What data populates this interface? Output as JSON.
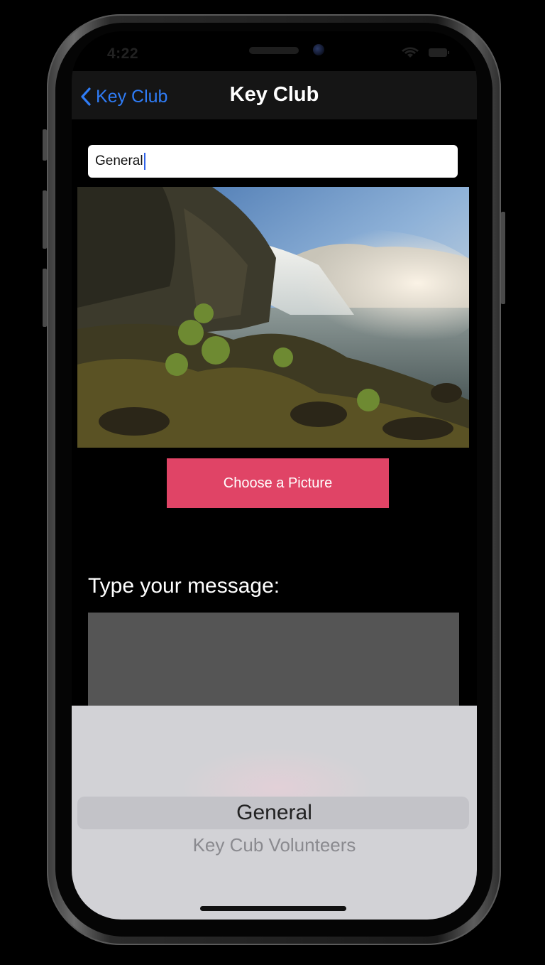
{
  "status_bar": {
    "time": "4:22"
  },
  "navbar": {
    "back_label": "Key Club",
    "title": "Key Club"
  },
  "topic_field": {
    "value": "General"
  },
  "hero_image": {
    "subject": "waterfall landscape photo"
  },
  "choose_button": {
    "label": "Choose a Picture"
  },
  "message": {
    "label": "Type your message:",
    "value": ""
  },
  "picker": {
    "options": [
      "General",
      "Key Cub Volunteers"
    ],
    "selected": "General"
  },
  "colors": {
    "accent_blue": "#2f7cf6",
    "button_pink": "#e04466",
    "message_area": "#555555",
    "picker_bg": "#d2d2d6"
  },
  "icons": [
    "back-chevron-icon",
    "wifi-icon",
    "battery-icon"
  ]
}
